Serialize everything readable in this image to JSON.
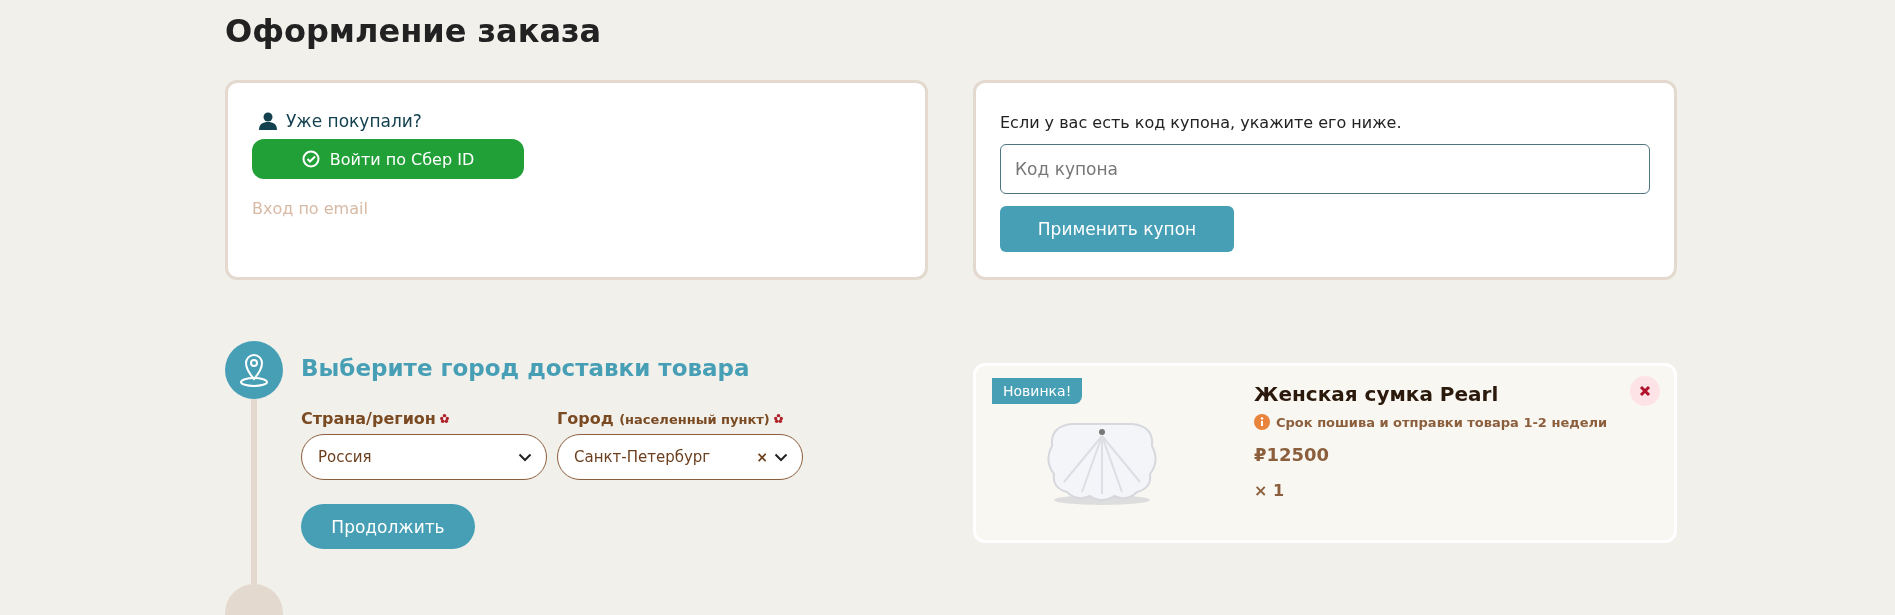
{
  "page_title": "Оформление заказа",
  "login": {
    "prompt": "Уже покупали?",
    "sber_button": "Войти по Сбер ID",
    "email_link": "Вход по email"
  },
  "coupon": {
    "hint": "Если у вас есть код купона, укажите его ниже.",
    "placeholder": "Код купона",
    "apply_button": "Применить купон"
  },
  "delivery_step": {
    "title": "Выберите город доставки товара",
    "fields": [
      {
        "label": "Страна/регион",
        "required": true,
        "value": "Россия",
        "clearable": false
      },
      {
        "label": "Город",
        "label_note": "(населенный пункт)",
        "required": true,
        "value": "Санкт-Петербург",
        "clearable": true,
        "clear_symbol": "×"
      }
    ],
    "continue_button": "Продолжить"
  },
  "cart_item": {
    "badge": "Новинка!",
    "name": "Женская сумка Pearl",
    "notice": "Срок пошива и отправки товара 1-2 недели",
    "price": "₽12500",
    "quantity": "× 1"
  }
}
